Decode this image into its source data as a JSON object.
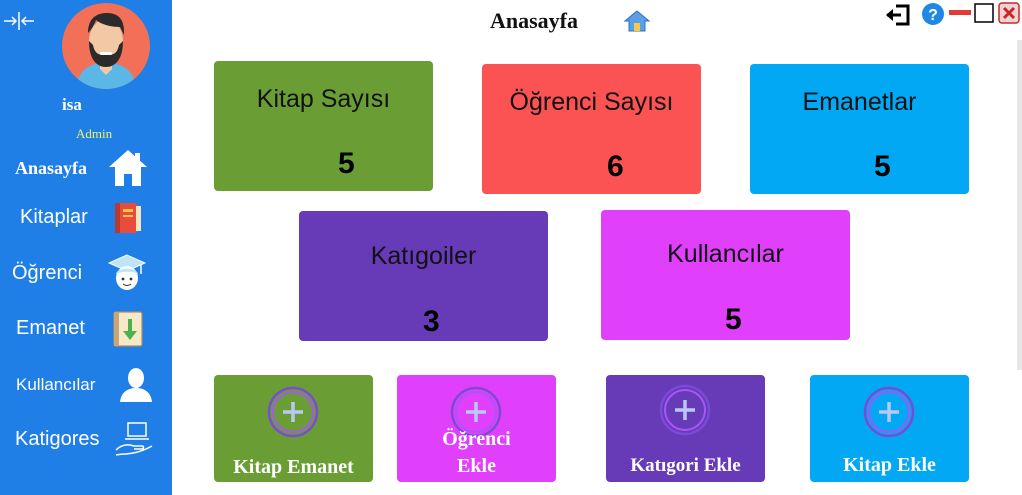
{
  "app": {
    "page_title": "Anasayfa"
  },
  "user": {
    "name": "isa",
    "role": "Admin"
  },
  "sidebar": {
    "items": [
      {
        "label": "Anasayfa",
        "icon": "home-icon"
      },
      {
        "label": "Kitaplar",
        "icon": "book-icon"
      },
      {
        "label": "Öğrenci",
        "icon": "student-icon"
      },
      {
        "label": "Emanet",
        "icon": "ledger-download-icon"
      },
      {
        "label": "Kullancılar",
        "icon": "user-icon"
      },
      {
        "label": "Katigores",
        "icon": "hand-laptop-icon"
      }
    ]
  },
  "stats": [
    {
      "label": "Kitap Sayısı",
      "value": "5",
      "color": "#6a9e35"
    },
    {
      "label": "Öğrenci Sayısı",
      "value": "6",
      "color": "#fb5253"
    },
    {
      "label": "Emanetlar",
      "value": "5",
      "color": "#02a8f3"
    },
    {
      "label": "Katıgoiler",
      "value": "3",
      "color": "#673ab7"
    },
    {
      "label": "Kullancılar",
      "value": "5",
      "color": "#e040fb"
    }
  ],
  "actions": [
    {
      "label": "Kitap Emanet",
      "color": "#6a9e35",
      "icon": "plus-circle-icon"
    },
    {
      "label_line1": "Öğrenci",
      "label_line2": "Ekle",
      "color": "#e040fb",
      "icon": "plus-circle-icon"
    },
    {
      "label": "Katıgori Ekle",
      "color": "#673ab7",
      "icon": "plus-circle-icon"
    },
    {
      "label": "Kitap Ekle",
      "color": "#02a8f3",
      "icon": "plus-circle-icon"
    }
  ],
  "window_controls": [
    "logout-icon",
    "help-icon",
    "minimize-icon",
    "maximize-icon",
    "close-icon"
  ],
  "colors": {
    "sidebar": "#1f7fe6",
    "avatar_bg": "#f26f58",
    "role_text": "#f3f36a"
  }
}
